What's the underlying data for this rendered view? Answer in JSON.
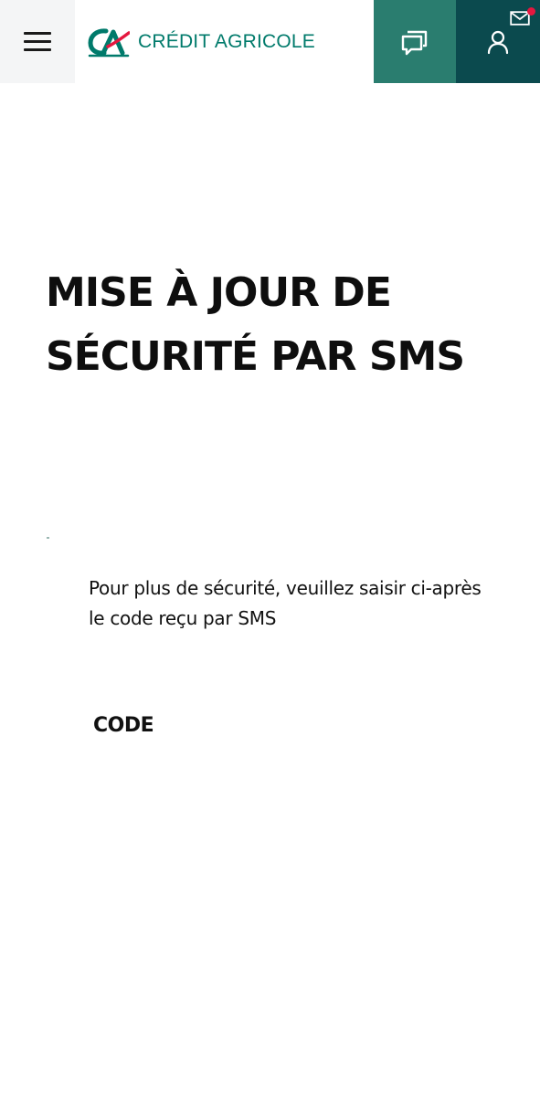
{
  "header": {
    "menu_icon": "hamburger-menu-icon",
    "logo_text": "CRÉDIT AGRICOLE",
    "chat_icon": "chat-bubbles-icon",
    "account_icon": "user-icon",
    "mail_icon": "envelope-icon",
    "colors": {
      "menu_bg": "#f4f5f6",
      "chat_bg": "#2a7d6f",
      "account_bg": "#0b4a4e",
      "brand_green": "#007a6b",
      "brand_red": "#e4173f"
    }
  },
  "main": {
    "title": "MISE À JOUR DE SÉCURITÉ PAR SMS",
    "instructions": "Pour plus de sécurité, veuillez saisir ci-après le code reçu par SMS",
    "code_label": "CODE",
    "code_value": ""
  }
}
